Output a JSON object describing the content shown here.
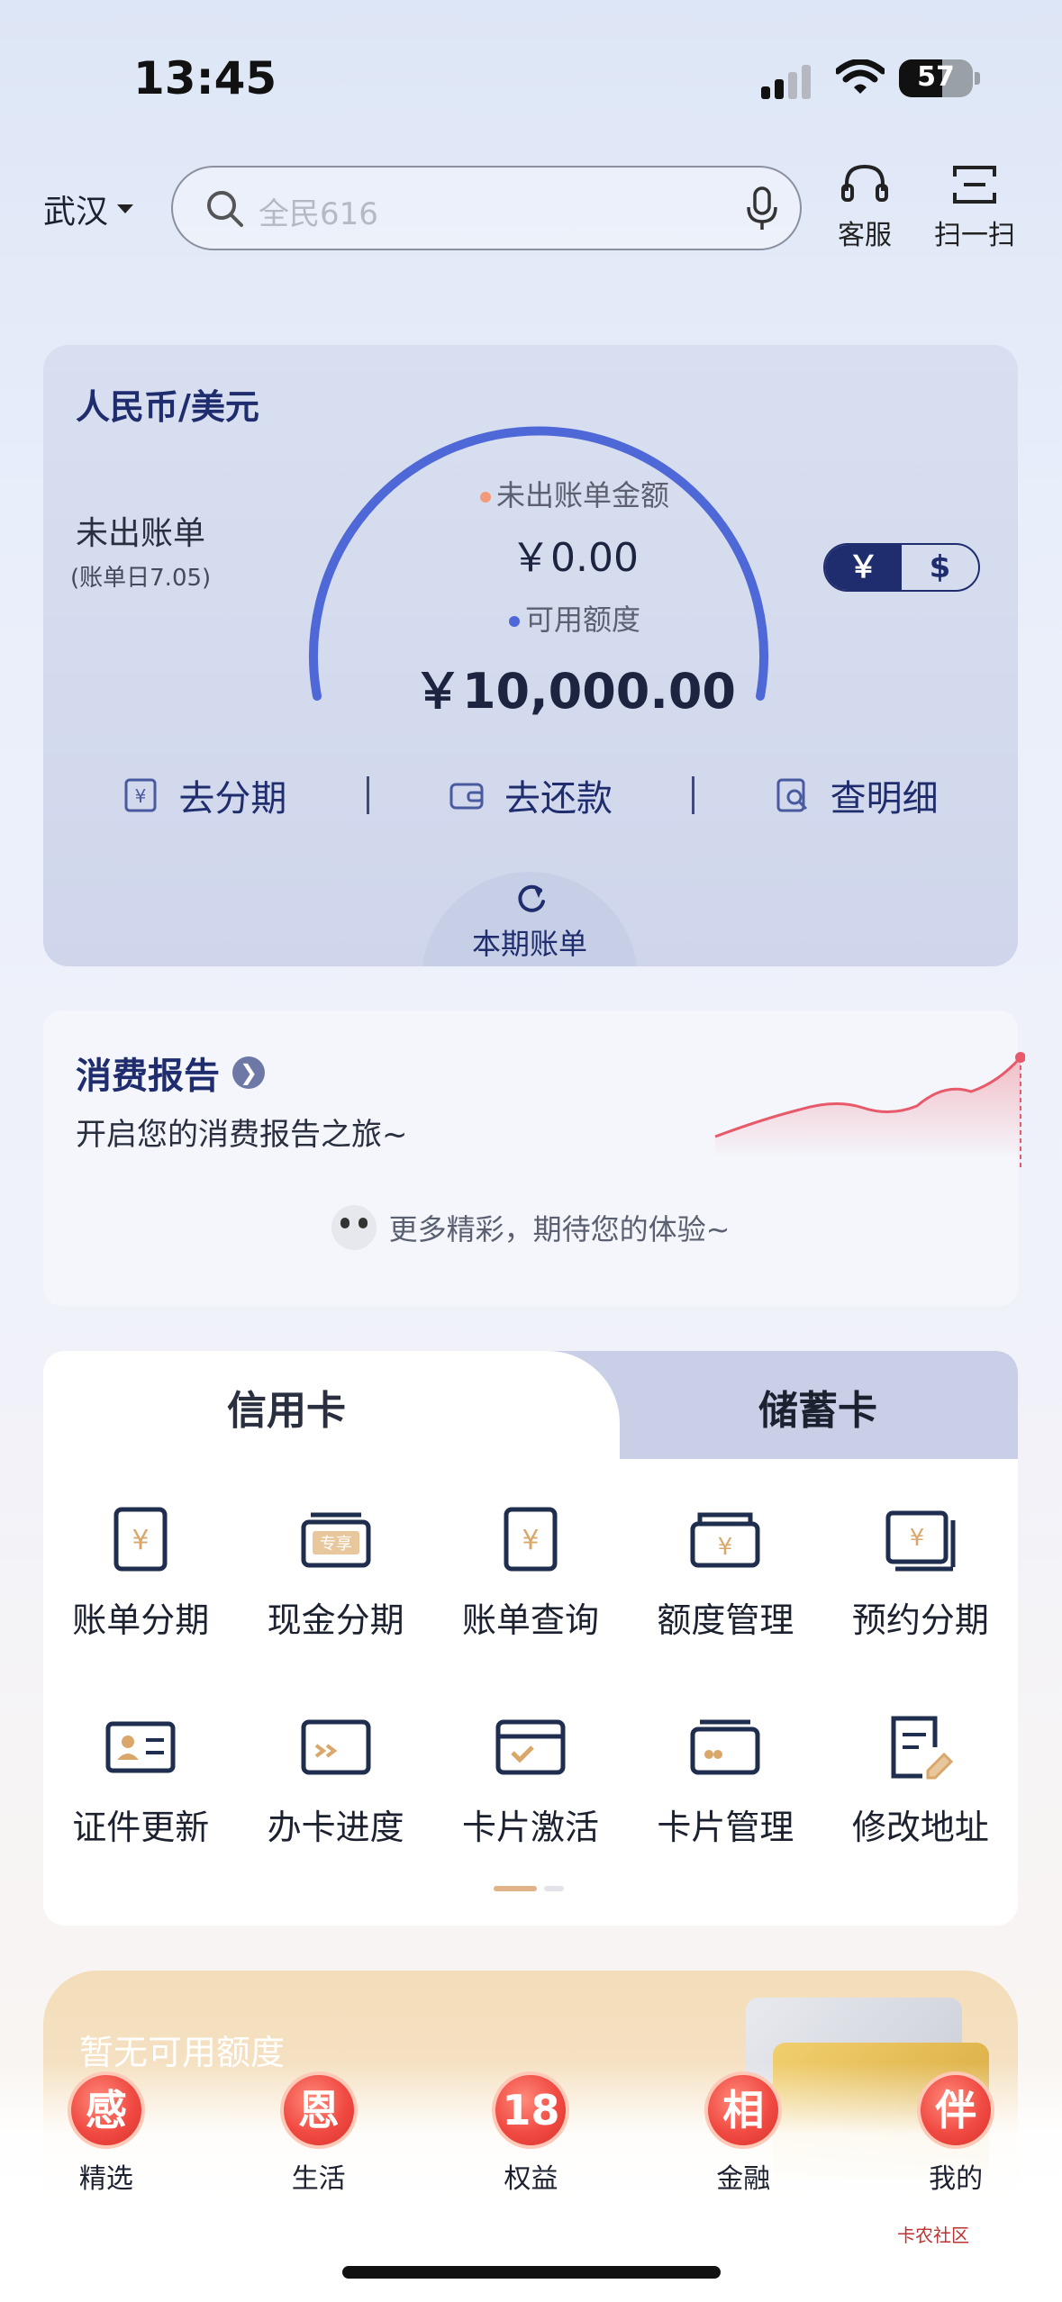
{
  "status": {
    "time": "13:45",
    "battery": "57"
  },
  "header": {
    "city": "武汉",
    "search_placeholder": "全民616",
    "service_label": "客服",
    "scan_label": "扫一扫"
  },
  "bill_card": {
    "title": "人民币/美元",
    "unbilled_label": "未出账单",
    "bill_day": "(账单日7.05)",
    "unbilled_amount_label": "未出账单金额",
    "unbilled_amount": "￥0.00",
    "available_label": "可用额度",
    "available_amount": "￥10,000.00",
    "currency_rmb": "￥",
    "currency_usd": "$",
    "actions": [
      {
        "label": "去分期",
        "icon": "installment-icon"
      },
      {
        "label": "去还款",
        "icon": "wallet-icon"
      },
      {
        "label": "查明细",
        "icon": "detail-search-icon"
      }
    ],
    "current_bill_label": "本期账单",
    "accent_color": "#4f68d8"
  },
  "report": {
    "title": "消费报告",
    "subtitle": "开启您的消费报告之旅~",
    "footer": "更多精彩，期待您的体验~"
  },
  "services": {
    "tabs": [
      "信用卡",
      "储蓄卡"
    ],
    "items": [
      {
        "label": "账单分期",
        "icon": "bill-installment-icon"
      },
      {
        "label": "现金分期",
        "icon": "cash-installment-icon"
      },
      {
        "label": "账单查询",
        "icon": "bill-query-icon"
      },
      {
        "label": "额度管理",
        "icon": "limit-management-icon"
      },
      {
        "label": "预约分期",
        "icon": "scheduled-installment-icon"
      },
      {
        "label": "证件更新",
        "icon": "id-card-icon"
      },
      {
        "label": "办卡进度",
        "icon": "card-progress-icon"
      },
      {
        "label": "卡片激活",
        "icon": "card-activate-icon"
      },
      {
        "label": "卡片管理",
        "icon": "card-manage-icon"
      },
      {
        "label": "修改地址",
        "icon": "edit-address-icon"
      }
    ]
  },
  "promo": {
    "text": "暂无可用额度"
  },
  "nav": {
    "items": [
      {
        "glyph": "感",
        "label": "精选"
      },
      {
        "glyph": "恩",
        "label": "生活"
      },
      {
        "glyph": "18",
        "label": "权益"
      },
      {
        "glyph": "相",
        "label": "金融"
      },
      {
        "glyph": "伴",
        "label": "我的"
      }
    ]
  },
  "watermark": "卡农社区"
}
